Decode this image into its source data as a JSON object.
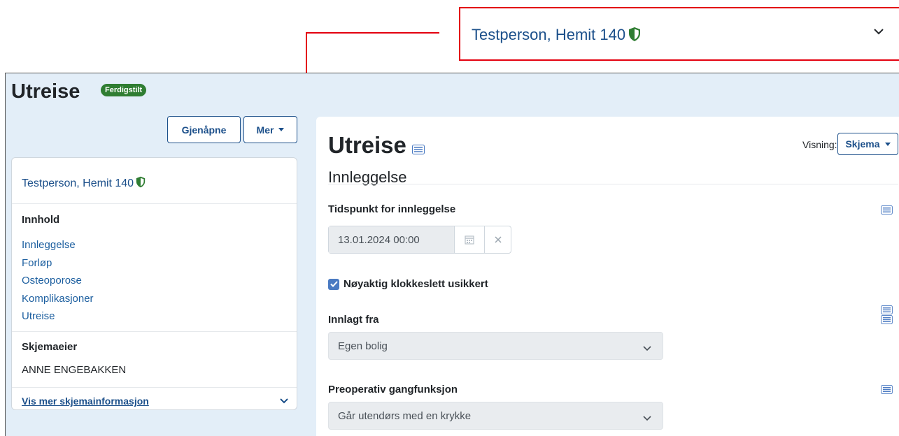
{
  "callout": {
    "patient_name": "Testperson, Hemit 140"
  },
  "header": {
    "title": "Utreise",
    "status_badge": "Ferdigstilt"
  },
  "toolbar": {
    "reopen_label": "Gjenåpne",
    "more_label": "Mer"
  },
  "sidebar": {
    "patient_name": "Testperson, Hemit 140",
    "contents_heading": "Innhold",
    "contents": [
      {
        "label": "Innleggelse"
      },
      {
        "label": "Forløp"
      },
      {
        "label": "Osteoporose"
      },
      {
        "label": "Komplikasjoner"
      },
      {
        "label": "Utreise"
      }
    ],
    "owner_heading": "Skjemaeier",
    "owner_name": "ANNE ENGEBAKKEN",
    "more_info_link": "Vis mer skjemainformasjon"
  },
  "form": {
    "title": "Utreise",
    "view_label": "Visning:",
    "view_value": "Skjema",
    "section_title": "Innleggelse",
    "fields": {
      "admission_time": {
        "label": "Tidspunkt for innleggelse",
        "value": "13.01.2024 00:00"
      },
      "exact_time_uncertain": {
        "label": "Nøyaktig klokkeslett usikkert",
        "checked": true
      },
      "admitted_from": {
        "label": "Innlagt fra",
        "value": "Egen bolig"
      },
      "preop_walking": {
        "label": "Preoperativ gangfunksjon",
        "value": "Går utendørs med en krykke"
      }
    }
  },
  "colors": {
    "accent": "#1b4f8a",
    "badge": "#2f7d32",
    "annotation": "#e3000f",
    "page_background": "#e3eef8"
  }
}
